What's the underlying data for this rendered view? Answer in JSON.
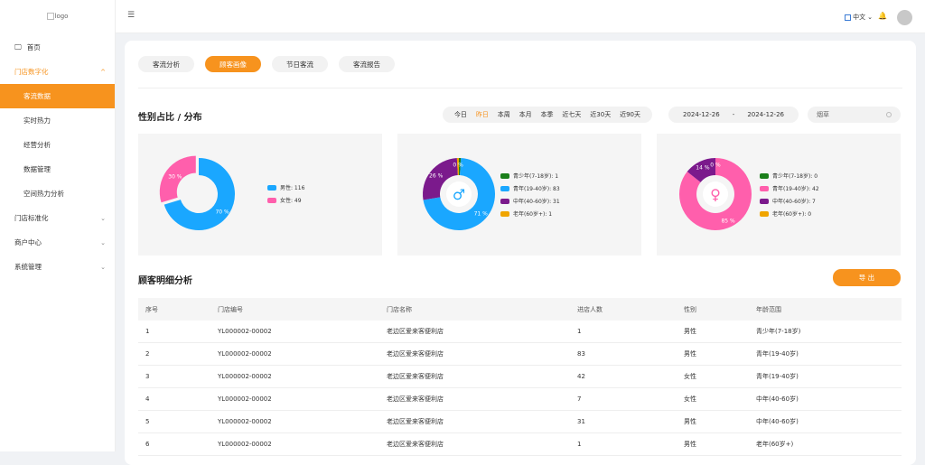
{
  "logo_alt": "logo",
  "sidebar": {
    "items": [
      {
        "label": "首页"
      },
      {
        "label": "门店数字化"
      },
      {
        "label": "客流数据"
      },
      {
        "label": "实时热力"
      },
      {
        "label": "经营分析"
      },
      {
        "label": "数据管理"
      },
      {
        "label": "空间热力分析"
      },
      {
        "label": "门店标准化"
      },
      {
        "label": "商户中心"
      },
      {
        "label": "系统管理"
      }
    ]
  },
  "header": {
    "lang": "中文"
  },
  "tabs": [
    {
      "label": "客流分析"
    },
    {
      "label": "顾客画像"
    },
    {
      "label": "节日客流"
    },
    {
      "label": "客流报告"
    }
  ],
  "section1_title": "性别占比 / 分布",
  "periods": [
    "今日",
    "昨日",
    "本周",
    "本月",
    "本季",
    "近七天",
    "近30天",
    "近90天"
  ],
  "date_start": "2024-12-26",
  "date_sep": "-",
  "date_end": "2024-12-26",
  "store_placeholder": "烟草",
  "colors": {
    "accent": "#f7931e",
    "blue": "#1aa7ff",
    "pink": "#ff5fac",
    "purple": "#7b1a8c",
    "green": "#1a7f1a",
    "yellow": "#f0a500"
  },
  "chart_data": [
    {
      "type": "pie",
      "labels": [
        "男性",
        "女性"
      ],
      "values": [
        116,
        49
      ],
      "legend": [
        "男性: 116",
        "女性: 49"
      ],
      "slice_labels": [
        "70 %",
        "30 %"
      ]
    },
    {
      "type": "pie",
      "legend": [
        "青少年(7-18岁): 1",
        "青年(19-40岁): 83",
        "中年(40-60岁): 31",
        "老年(60岁+): 1"
      ],
      "values": [
        1,
        83,
        31,
        1
      ],
      "slice_labels": [
        "",
        "71 %",
        "26 %",
        "0 %"
      ]
    },
    {
      "type": "pie",
      "legend": [
        "青少年(7-18岁): 0",
        "青年(19-40岁): 42",
        "中年(40-60岁): 7",
        "老年(60岁+): 0"
      ],
      "values": [
        0,
        42,
        7,
        0
      ],
      "slice_labels": [
        "",
        "85 %",
        "14 %",
        "0 %"
      ]
    }
  ],
  "section2_title": "顾客明细分析",
  "export_label": "导 出",
  "table": {
    "headers": [
      "序号",
      "门店编号",
      "门店名称",
      "进店人数",
      "性别",
      "年龄范围"
    ],
    "rows": [
      [
        "1",
        "YL000002-00002",
        "老边区爱来客便利店",
        "1",
        "男性",
        "青少年(7-18岁)"
      ],
      [
        "2",
        "YL000002-00002",
        "老边区爱来客便利店",
        "83",
        "男性",
        "青年(19-40岁)"
      ],
      [
        "3",
        "YL000002-00002",
        "老边区爱来客便利店",
        "42",
        "女性",
        "青年(19-40岁)"
      ],
      [
        "4",
        "YL000002-00002",
        "老边区爱来客便利店",
        "7",
        "女性",
        "中年(40-60岁)"
      ],
      [
        "5",
        "YL000002-00002",
        "老边区爱来客便利店",
        "31",
        "男性",
        "中年(40-60岁)"
      ],
      [
        "6",
        "YL000002-00002",
        "老边区爱来客便利店",
        "1",
        "男性",
        "老年(60岁+)"
      ]
    ]
  }
}
